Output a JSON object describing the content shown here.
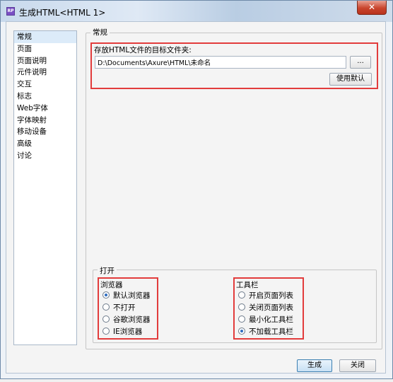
{
  "window": {
    "title": "生成HTML<HTML 1>",
    "app_icon_text": "RP",
    "close_glyph": "✕"
  },
  "nav": {
    "items": [
      "常规",
      "页面",
      "页面说明",
      "元件说明",
      "交互",
      "标志",
      "Web字体",
      "字体映射",
      "移动设备",
      "高级",
      "讨论"
    ],
    "selected_index": 0
  },
  "general": {
    "legend": "常规",
    "folder_label": "存放HTML文件的目标文件夹:",
    "folder_path": "D:\\Documents\\Axure\\HTML\\未命名",
    "browse_label": "...",
    "use_default_label": "使用默认"
  },
  "open": {
    "legend": "打开",
    "browser": {
      "label": "浏览器",
      "options": [
        "默认浏览器",
        "不打开",
        "谷歌浏览器",
        "IE浏览器"
      ],
      "selected_index": 0
    },
    "toolbar": {
      "label": "工具栏",
      "options": [
        "开启页面列表",
        "关闭页面列表",
        "最小化工具栏",
        "不加载工具栏"
      ],
      "selected_index": 3
    }
  },
  "footer": {
    "generate_label": "生成",
    "close_label": "关闭"
  },
  "colors": {
    "highlight": "#e23c3c",
    "accent": "#2d6cc0"
  }
}
